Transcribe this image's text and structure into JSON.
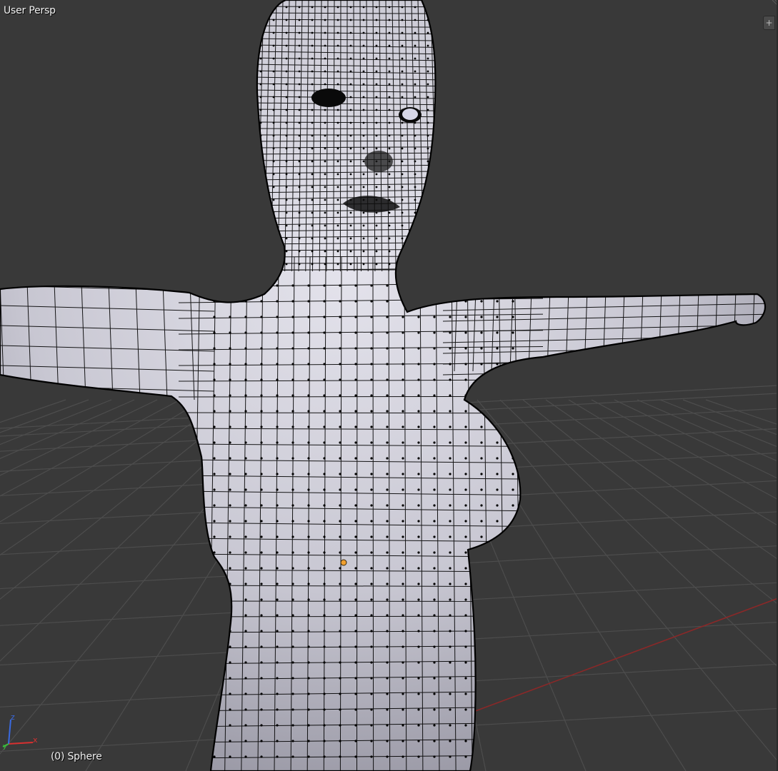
{
  "viewport": {
    "view_label": "User Persp",
    "object_label": "(0) Sphere",
    "add_region_icon": "plus-icon",
    "axes": {
      "x": "x",
      "y": "y",
      "z": "z"
    },
    "colors": {
      "background": "#393939",
      "grid": "#4c4c4c",
      "x_axis": "#8a2a2a",
      "y_axis": "#5f8a2a",
      "mesh_fill": "#c9c8d3",
      "wire": "#000000",
      "origin": "#f0a030"
    }
  }
}
